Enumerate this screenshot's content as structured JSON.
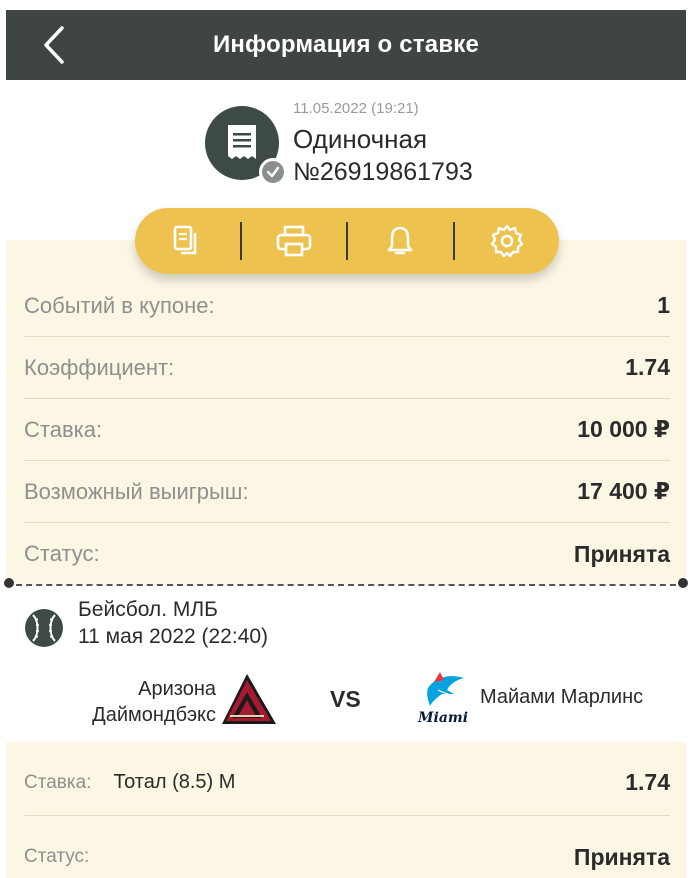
{
  "header": {
    "title": "Информация о ставке",
    "back_icon": "chevron-left-icon"
  },
  "coupon": {
    "date": "11.05.2022 (19:21)",
    "type": "Одиночная",
    "number": "№26919861793",
    "icon": "receipt-icon",
    "badge_icon": "checkmark-icon"
  },
  "actions": [
    {
      "name": "copy",
      "icon": "copy-icon"
    },
    {
      "name": "print",
      "icon": "print-icon"
    },
    {
      "name": "notify",
      "icon": "bell-icon"
    },
    {
      "name": "settings",
      "icon": "gear-icon"
    }
  ],
  "summary": [
    {
      "label": "Событий в купоне:",
      "value": "1"
    },
    {
      "label": "Коэффициент:",
      "value": "1.74"
    },
    {
      "label": "Ставка:",
      "value": "10 000 ₽"
    },
    {
      "label": "Возможный выигрыш:",
      "value": "17 400 ₽"
    },
    {
      "label": "Статус:",
      "value": "Принята"
    }
  ],
  "event": {
    "sport": "Бейсбол. МЛБ",
    "datetime": "11 мая 2022 (22:40)",
    "icon": "baseball-icon",
    "team1_line1": "Аризона",
    "team1_line2": "Даймондбэкс",
    "vs": "VS",
    "team2": "Майами Марлинс",
    "logo2_text": "Miami"
  },
  "bet": {
    "stake_label": "Ставка:",
    "market": "Тотал (8.5) М",
    "coef": "1.74",
    "status_label": "Статус:",
    "status": "Принята"
  },
  "colors": {
    "header": "#3f4444",
    "accent": "#eec24f",
    "panel": "#fcf7e4"
  }
}
